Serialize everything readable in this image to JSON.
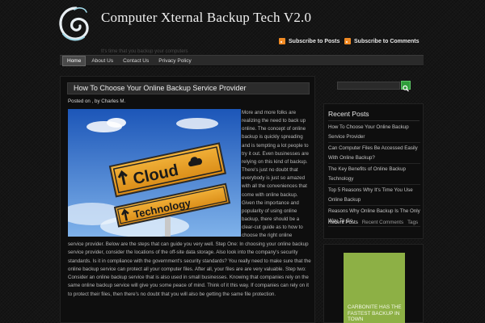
{
  "header": {
    "title": "Computer Xternal Backup Tech V2.0",
    "tagline": "It's time that you backup your computers",
    "subscribe_posts": "Subscribe to Posts",
    "subscribe_comments": "Subscribe to Comments"
  },
  "nav": {
    "items": [
      "Home",
      "About Us",
      "Contact Us",
      "Privacy Policy"
    ],
    "active": "Home"
  },
  "post": {
    "title": "How To Choose Your Online Backup Service Provider",
    "meta_prefix": "Posted on , by",
    "author": "Charles M.",
    "image": {
      "sign_top": "Cloud",
      "sign_bottom": "Technology"
    },
    "float_text": "More and more folks are realizing the need to back up online. The concept of online backup is quickly spreading and is tempting a lot people to try it out. Even businesses are relying on this kind of backup. There's just no doubt that everybody is just so amazed with all the conveniences that come with online backup. Given the importance and popularity of using online backup, there should be a clear-cut guide as to how to choose the right online",
    "full_text": "service provider. Below are the steps that can guide you very well. Step One: In choosing your online backup service provider, consider the locations of the off-site data storage. Also look into the company's security standards. Is it in compliance with the government's security standards? You really need to make sure that the online backup service can protect all your computer files. After all, your files are are very valuable. Step two: Consider an online backup service that is also used in small businesses. Knowing that companies rely on the same online backup service will give you some peace of mind. Think of it this way. If companies can rely on it to protect their files, then there's no doubt that you will also be getting the same file protection."
  },
  "sidebar": {
    "heading": "Recent Posts",
    "recent_posts": [
      "How To Choose Your Online Backup Service Provider",
      "Can Computer Files Be Accessed Easily With Online Backup?",
      "The Key Benefits of Online Backup Technology",
      "Top 5 Reasons Why It's Time You Use Online Backup",
      "Reasons Why Online Backup Is The Only Way To Go"
    ],
    "tabs": [
      "Recent Posts",
      "Recent Comments",
      "Tags"
    ],
    "active_tab": "Recent Posts",
    "ad_text": "CARBONITE HAS THE FASTEST BACKUP IN TOWN"
  },
  "colors": {
    "background": "#151515",
    "accent_green": "#2f9d3a",
    "ad_green": "#8db045",
    "rss_orange": "#f08a24",
    "sign_orange": "#e9a127"
  },
  "icons": {
    "logo": "swirl-logo-icon",
    "rss": "rss-icon",
    "search": "search-icon"
  }
}
